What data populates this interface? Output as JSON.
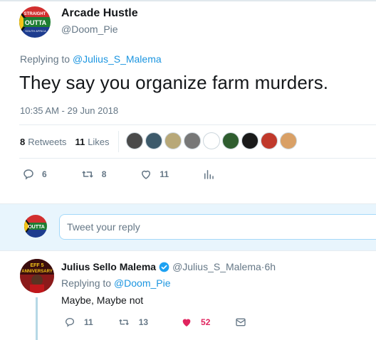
{
  "main_tweet": {
    "author_name": "Arcade Hustle",
    "author_handle": "@Doom_Pie",
    "avatar_text": [
      "STRAIGHT",
      "OUTTA",
      "SOUTH AFRICA"
    ],
    "replying_prefix": "Replying to ",
    "replying_to": "@Julius_S_Malema",
    "text": "They say you organize farm murders.",
    "timestamp": "10:35 AM - 29 Jun 2018",
    "retweets_count": "8",
    "retweets_label": "Retweets",
    "likes_count": "11",
    "likes_label": "Likes",
    "likers": [
      "#4a4a4a",
      "#3d5a6b",
      "#b8a878",
      "#777777",
      "#ffffff",
      "#2f5d2f",
      "#1a1a1a",
      "#c0392b",
      "#d9a066"
    ],
    "actions": {
      "reply_count": "6",
      "retweet_count": "8",
      "like_count": "11"
    }
  },
  "reply_box": {
    "placeholder": "Tweet your reply",
    "avatar_text": "OUTTA"
  },
  "reply_tweet": {
    "author_name": "Julius Sello Malema",
    "author_handle": "@Julius_S_Malema",
    "separator": " · ",
    "time": "6h",
    "avatar_text": [
      "EFF 5",
      "ANNIVERSARY"
    ],
    "replying_prefix": "Replying to ",
    "replying_to": "@Doom_Pie",
    "text": "Maybe, Maybe not",
    "actions": {
      "reply_count": "11",
      "retweet_count": "13",
      "like_count": "52"
    }
  },
  "colors": {
    "link": "#1b95e0",
    "muted": "#657786",
    "like_red": "#e0245e",
    "verified_blue": "#1da1f2"
  }
}
